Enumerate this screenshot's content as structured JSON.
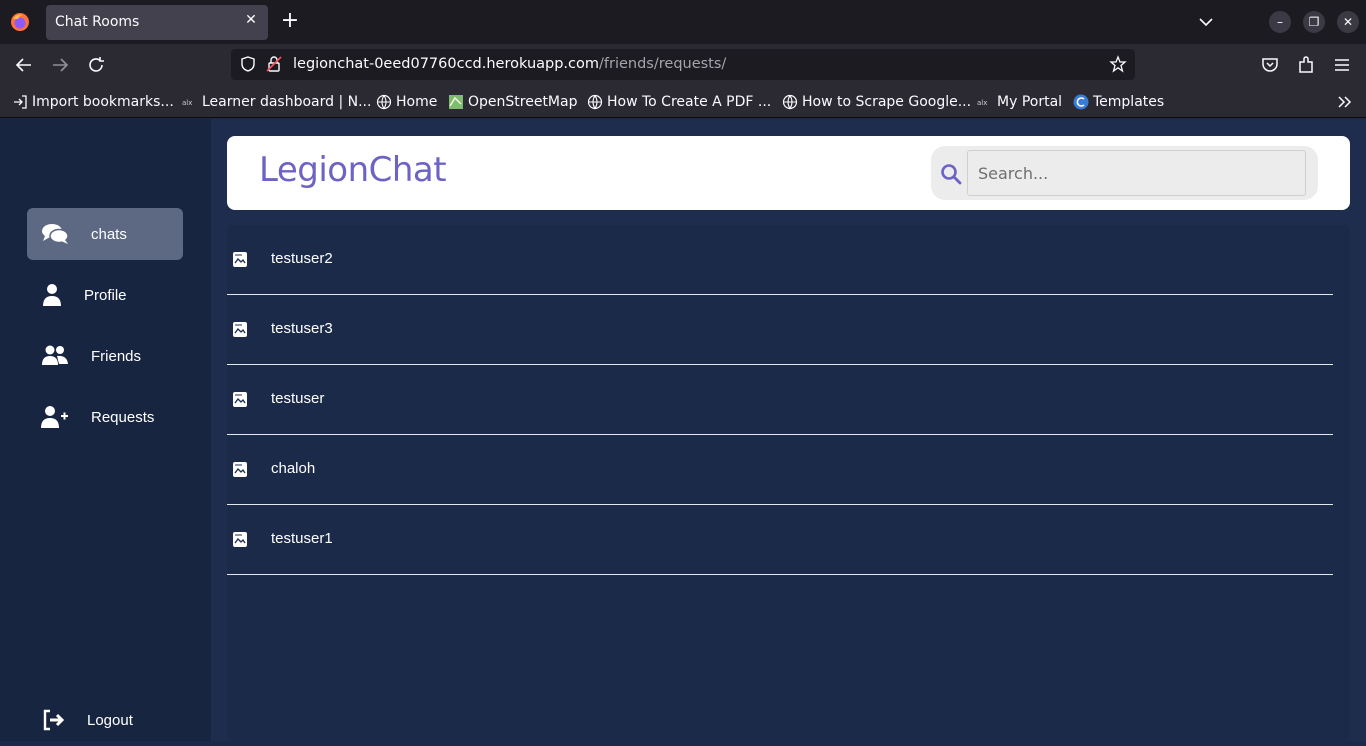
{
  "browser": {
    "tab_title": "Chat Rooms",
    "url_host": "legionchat-0eed07760ccd.herokuapp.com",
    "url_path": "/friends/requests/",
    "bookmarks": [
      {
        "label": "Import bookmarks...",
        "icon": "import-icon"
      },
      {
        "label": "Learner dashboard | N...",
        "icon": "alx-icon"
      },
      {
        "label": "Home",
        "icon": "globe-icon"
      },
      {
        "label": "OpenStreetMap",
        "icon": "map-icon"
      },
      {
        "label": "How To Create A PDF ...",
        "icon": "globe-icon"
      },
      {
        "label": "How to Scrape Google...",
        "icon": "globe-icon"
      },
      {
        "label": "My Portal",
        "icon": "alx-icon"
      },
      {
        "label": "Templates",
        "icon": "canva-icon"
      }
    ]
  },
  "app": {
    "brand": "LegionChat",
    "search_placeholder": "Search...",
    "sidebar": {
      "items": [
        {
          "label": "chats",
          "icon": "chat-bubbles-icon",
          "active": true
        },
        {
          "label": "Profile",
          "icon": "user-icon"
        },
        {
          "label": "Friends",
          "icon": "users-icon"
        },
        {
          "label": "Requests",
          "icon": "user-plus-icon"
        }
      ],
      "logout": "Logout"
    },
    "requests": [
      {
        "name": "testuser2"
      },
      {
        "name": "testuser3"
      },
      {
        "name": "testuser"
      },
      {
        "name": "chaloh"
      },
      {
        "name": "testuser1"
      }
    ]
  },
  "colors": {
    "brand": "#6c63c4",
    "sidebar_bg": "#182541",
    "main_bg": "#1e2d4e",
    "active_item": "#5d6982"
  }
}
